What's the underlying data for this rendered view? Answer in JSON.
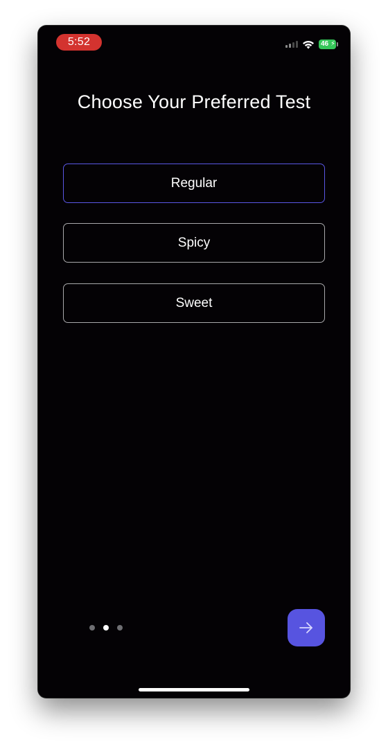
{
  "status_bar": {
    "time": "5:52",
    "battery_level": "46",
    "battery_charging": true,
    "battery_color": "#35c759",
    "time_pill_color": "#d3332f",
    "icons": [
      "signal-icon",
      "wifi-icon",
      "battery-icon"
    ]
  },
  "screen": {
    "title": "Choose Your Preferred Test"
  },
  "options": [
    {
      "label": "Regular",
      "selected": true
    },
    {
      "label": "Spicy",
      "selected": false
    },
    {
      "label": "Sweet",
      "selected": false
    }
  ],
  "pagination": {
    "current_page": 2,
    "total_pages": 3
  },
  "next_button": {
    "icon": "arrow-right-icon",
    "color": "#5754e0"
  },
  "colors": {
    "background": "#040205",
    "accent": "#5a57e6",
    "text": "#ffffff"
  }
}
